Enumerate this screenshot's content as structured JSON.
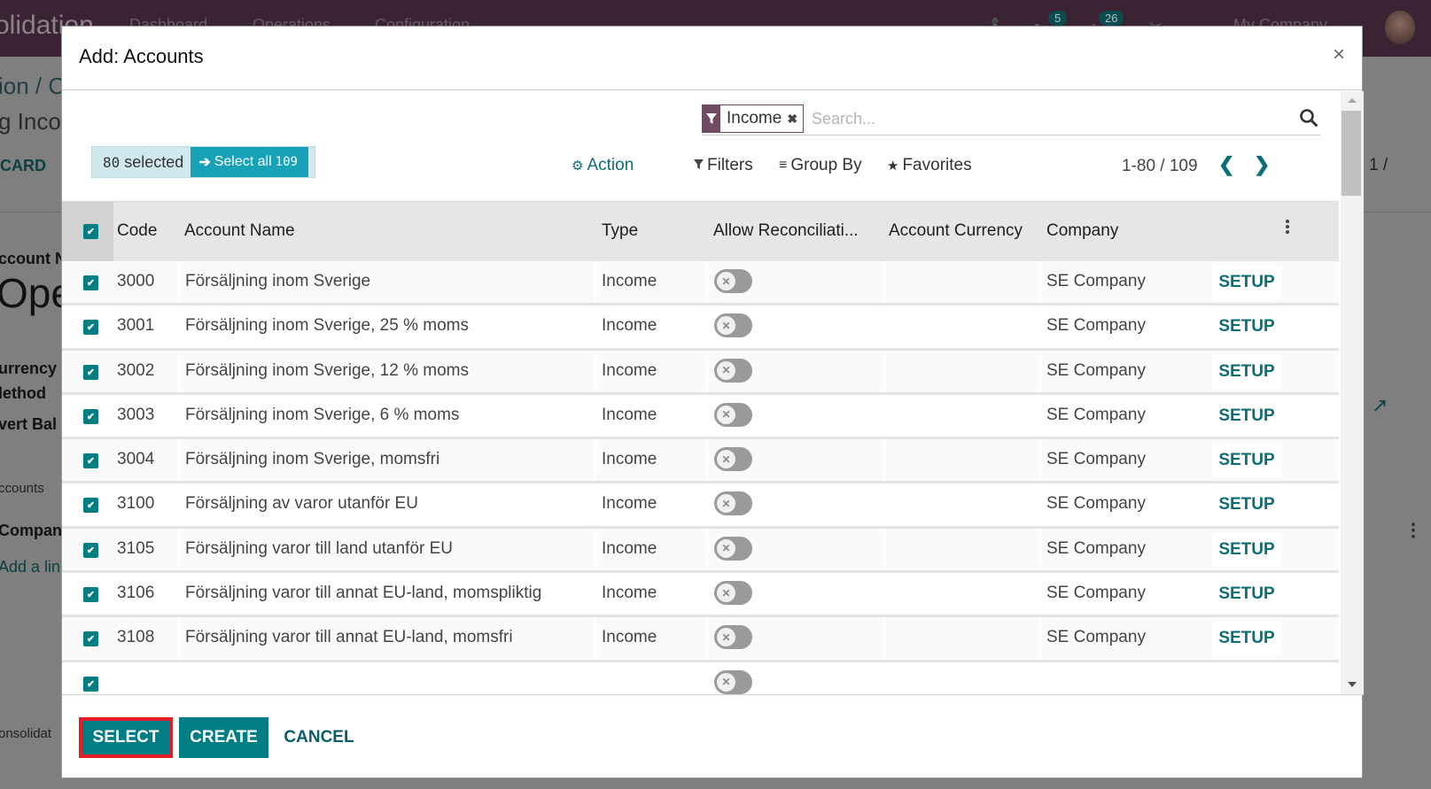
{
  "background_app": {
    "app_name": "olidation",
    "nav": [
      "Dashboard",
      "Operations",
      "Configuration"
    ],
    "badges": {
      "messages": "5",
      "activities": "26"
    },
    "company": "My Company",
    "breadcrumb": "ion / C",
    "record_subtitle": "g Incor",
    "discard": "CARD",
    "pager": "1 /",
    "field_label_account": "ccount N",
    "big_title": "Ope",
    "currency_label": "urrency",
    "method_label": "lethod",
    "invert_label": "vert Bal",
    "accounts_tab": "ccounts",
    "company_col": "Company",
    "add_line": "Add a line",
    "footer_crumb": "onsolidat"
  },
  "modal": {
    "title": "Add: Accounts",
    "close_label": "×",
    "search": {
      "facet_label": "Income",
      "facet_remove": "✖",
      "placeholder": "Search...",
      "value": ""
    },
    "selection": {
      "count": "80",
      "count_suffix": "selected",
      "select_all_prefix": "Select all",
      "select_all_count": "109"
    },
    "control_panel": {
      "action": "Action",
      "filters": "Filters",
      "group_by": "Group By",
      "favorites": "Favorites"
    },
    "pager": {
      "value": "1-80 / 109",
      "prev": "❮",
      "next": "❯"
    },
    "table": {
      "columns": [
        "Code",
        "Account Name",
        "Type",
        "Allow Reconciliati...",
        "Account Currency",
        "Company"
      ],
      "rows": [
        {
          "code": "3000",
          "name": "Försäljning inom Sverige",
          "type": "Income",
          "reconcile": false,
          "currency": "",
          "company": "SE Company",
          "action": "SETUP",
          "selected": true
        },
        {
          "code": "3001",
          "name": "Försäljning inom Sverige, 25 % moms",
          "type": "Income",
          "reconcile": false,
          "currency": "",
          "company": "SE Company",
          "action": "SETUP",
          "selected": true
        },
        {
          "code": "3002",
          "name": "Försäljning inom Sverige, 12 % moms",
          "type": "Income",
          "reconcile": false,
          "currency": "",
          "company": "SE Company",
          "action": "SETUP",
          "selected": true
        },
        {
          "code": "3003",
          "name": "Försäljning inom Sverige, 6 % moms",
          "type": "Income",
          "reconcile": false,
          "currency": "",
          "company": "SE Company",
          "action": "SETUP",
          "selected": true
        },
        {
          "code": "3004",
          "name": "Försäljning inom Sverige, momsfri",
          "type": "Income",
          "reconcile": false,
          "currency": "",
          "company": "SE Company",
          "action": "SETUP",
          "selected": true
        },
        {
          "code": "3100",
          "name": "Försäljning av varor utanför EU",
          "type": "Income",
          "reconcile": false,
          "currency": "",
          "company": "SE Company",
          "action": "SETUP",
          "selected": true
        },
        {
          "code": "3105",
          "name": "Försäljning varor till land utanför EU",
          "type": "Income",
          "reconcile": false,
          "currency": "",
          "company": "SE Company",
          "action": "SETUP",
          "selected": true
        },
        {
          "code": "3106",
          "name": "Försäljning varor till annat EU-land, momspliktig",
          "type": "Income",
          "reconcile": false,
          "currency": "",
          "company": "SE Company",
          "action": "SETUP",
          "selected": true
        },
        {
          "code": "3108",
          "name": "Försäljning varor till annat EU-land, momsfri",
          "type": "Income",
          "reconcile": false,
          "currency": "",
          "company": "SE Company",
          "action": "SETUP",
          "selected": true
        },
        {
          "code": "",
          "name": "",
          "type": "",
          "reconcile": false,
          "currency": "",
          "company": "",
          "action": "",
          "selected": true
        }
      ]
    },
    "footer": {
      "select": "SELECT",
      "create": "CREATE",
      "cancel": "CANCEL"
    }
  },
  "colors": {
    "primary": "#017e84",
    "link": "#0b6e75",
    "navbar": "#3a2433",
    "facet": "#6f4a63",
    "highlight": "#e41e26",
    "select_all": "#17a2b8"
  }
}
